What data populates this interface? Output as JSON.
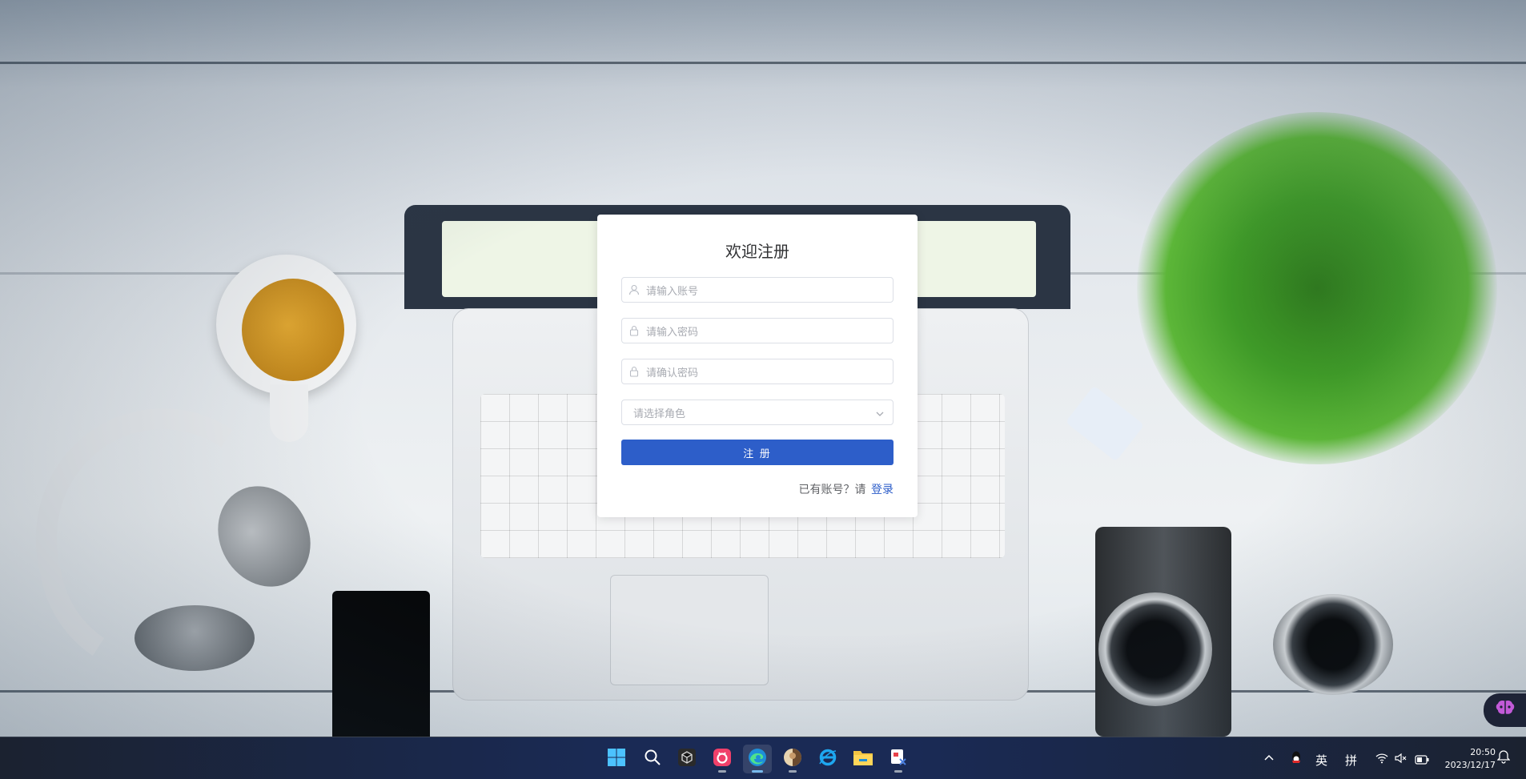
{
  "register_card": {
    "title": "欢迎注册",
    "username_placeholder": "请输入账号",
    "password_placeholder": "请输入密码",
    "confirm_password_placeholder": "请确认密码",
    "role_placeholder": "请选择角色",
    "register_button_label": "注 册",
    "has_account_text": "已有账号？请",
    "login_link_label": "登录"
  },
  "taskbar": {
    "apps": [
      {
        "name": "start-menu",
        "icon": "windows-logo-icon"
      },
      {
        "name": "search",
        "icon": "search-icon"
      },
      {
        "name": "app-3d",
        "icon": "cube-app-icon"
      },
      {
        "name": "app-pink",
        "icon": "pink-app-icon"
      },
      {
        "name": "edge",
        "icon": "edge-browser-icon",
        "active": true
      },
      {
        "name": "app-photo",
        "icon": "photo-app-icon"
      },
      {
        "name": "ie",
        "icon": "ie-browser-icon"
      },
      {
        "name": "file-explorer",
        "icon": "folder-icon"
      },
      {
        "name": "snipping-tool",
        "icon": "snip-icon"
      }
    ],
    "tray": {
      "ime_lang": "英",
      "ime_mode": "拼",
      "time": "20:50",
      "date": "2023/12/17"
    }
  },
  "colors": {
    "primary": "#2d5ec9",
    "card_bg": "#ffffff",
    "placeholder": "#a8abb2",
    "taskbar_bg": "#1a2a55"
  }
}
